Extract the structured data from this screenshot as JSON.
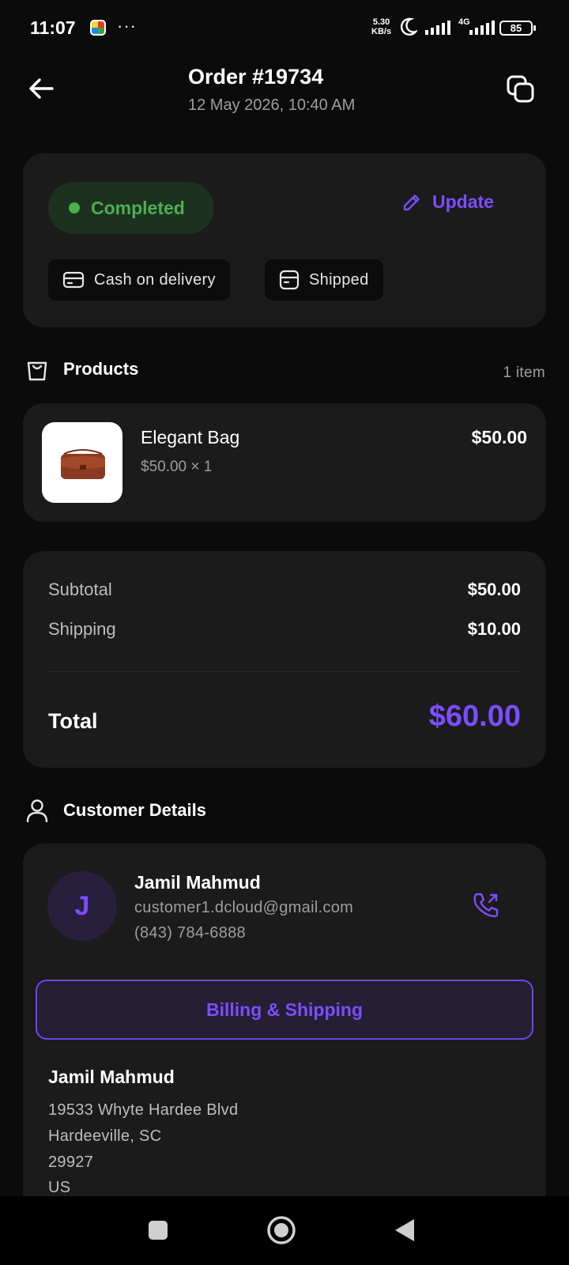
{
  "status_bar": {
    "time": "11:07",
    "dots": "···",
    "speed_value": "5.30",
    "speed_unit": "KB/s",
    "network": "4G",
    "battery": "85"
  },
  "header": {
    "title": "Order #19734",
    "date": "12 May 2026, 10:40 AM"
  },
  "status_card": {
    "status": "Completed",
    "status_color": "#4caf50",
    "update_label": "Update",
    "payment_chip": "Cash on delivery",
    "shipping_chip": "Shipped"
  },
  "products": {
    "section_title": "Products",
    "count": "1 item",
    "items": [
      {
        "name": "Elegant Bag",
        "qty_line": "$50.00 × 1",
        "price": "$50.00"
      }
    ]
  },
  "totals": {
    "subtotal_label": "Subtotal",
    "subtotal": "$50.00",
    "shipping_label": "Shipping",
    "shipping": "$10.00",
    "total_label": "Total",
    "total": "$60.00"
  },
  "customer": {
    "section_title": "Customer Details",
    "initial": "J",
    "name": "Jamil Mahmud",
    "email": "customer1.dcloud@gmail.com",
    "phone": "(843) 784-6888",
    "billing_button": "Billing & Shipping"
  },
  "address": {
    "name": "Jamil Mahmud",
    "line1": "19533 Whyte Hardee Blvd",
    "line2": "Hardeeville, SC",
    "zip": "29927",
    "country": "US"
  },
  "theme": {
    "accent": "#7c4dff",
    "background": "#0b0b0b",
    "card": "#1b1b1b"
  },
  "icons": [
    "back-arrow-icon",
    "copy-icon",
    "pencil-icon",
    "card-icon",
    "package-icon",
    "bag-icon",
    "user-icon",
    "phone-call-icon"
  ]
}
